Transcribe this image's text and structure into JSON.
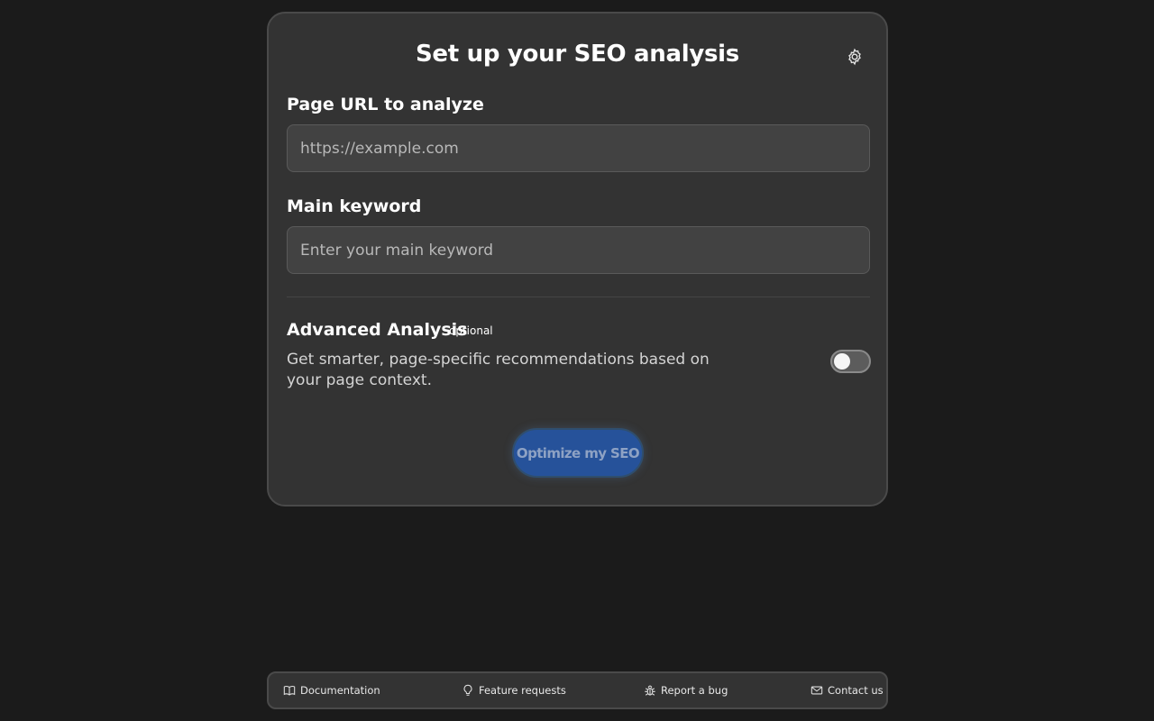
{
  "card": {
    "title": "Set up your SEO analysis",
    "settings_icon": "gear-icon"
  },
  "url_field": {
    "label": "Page URL to analyze",
    "value": "",
    "placeholder": "https://example.com"
  },
  "keyword_field": {
    "label": "Main keyword",
    "value": "",
    "placeholder": "Enter your main keyword"
  },
  "advanced": {
    "title": "Advanced Analysis",
    "badge": "optional",
    "description": "Get smarter, page-specific recommendations based on your page context.",
    "enabled": false
  },
  "submit": {
    "label": "Optimize my SEO",
    "color": "#26529a"
  },
  "footer": {
    "links": [
      {
        "label": "Documentation",
        "icon": "book-icon"
      },
      {
        "label": "Feature requests",
        "icon": "lightbulb-icon"
      },
      {
        "label": "Report a bug",
        "icon": "bug-icon"
      },
      {
        "label": "Contact us",
        "icon": "mail-icon"
      }
    ]
  },
  "colors": {
    "background": "#1b1b1b",
    "card": "#333333",
    "accent": "#26529a"
  }
}
